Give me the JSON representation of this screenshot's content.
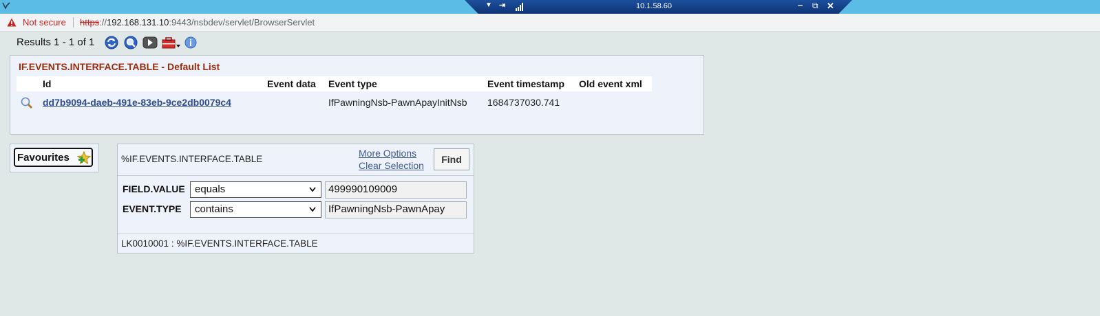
{
  "window": {
    "remote_host_ip": "10.1.58.60",
    "controls": {
      "minimize": "–",
      "restore": "⧉",
      "close": "✕"
    }
  },
  "address_bar": {
    "security_status": "Not secure",
    "url_scheme": "https",
    "url_rest_prefix": "://",
    "url_host": "192.168.131.10",
    "url_path": ":9443/nsbdev/servlet/BrowserServlet"
  },
  "toolbar": {
    "results_text": "Results 1 - 1 of 1",
    "icons": [
      "refresh-icon",
      "search-icon",
      "play-icon",
      "tools-icon",
      "info-icon"
    ]
  },
  "list": {
    "title": "IF.EVENTS.INTERFACE.TABLE - Default List",
    "columns": [
      "Id",
      "Event data",
      "Event type",
      "Event timestamp",
      "Old event xml"
    ],
    "rows": [
      {
        "id": "dd7b9094-daeb-491e-83eb-9ce2db0079c4",
        "event_data": "",
        "event_type": "IfPawningNsb-PawnApayInitNsb",
        "event_timestamp": "1684737030.741",
        "old_event_xml": ""
      }
    ]
  },
  "favourites": {
    "label": "Favourites"
  },
  "selection": {
    "title": "%IF.EVENTS.INTERFACE.TABLE",
    "more_options": "More Options",
    "clear_selection": "Clear Selection",
    "find_label": "Find",
    "criteria": [
      {
        "field": "FIELD.VALUE",
        "operator": "equals",
        "value": "499990109009"
      },
      {
        "field": "EVENT.TYPE",
        "operator": "contains",
        "value": "IfPawningNsb-PawnApay"
      }
    ],
    "footer": "LK0010001 : %IF.EVENTS.INTERFACE.TABLE"
  },
  "colors": {
    "titlebar": "#5bbde6",
    "rdp_bar": "#0f3476",
    "page_bg": "#dfe8e6",
    "panel_bg": "#eef2fa",
    "list_title": "#9a2b0b",
    "link": "#2e4b8a",
    "warning": "#c5221f"
  }
}
